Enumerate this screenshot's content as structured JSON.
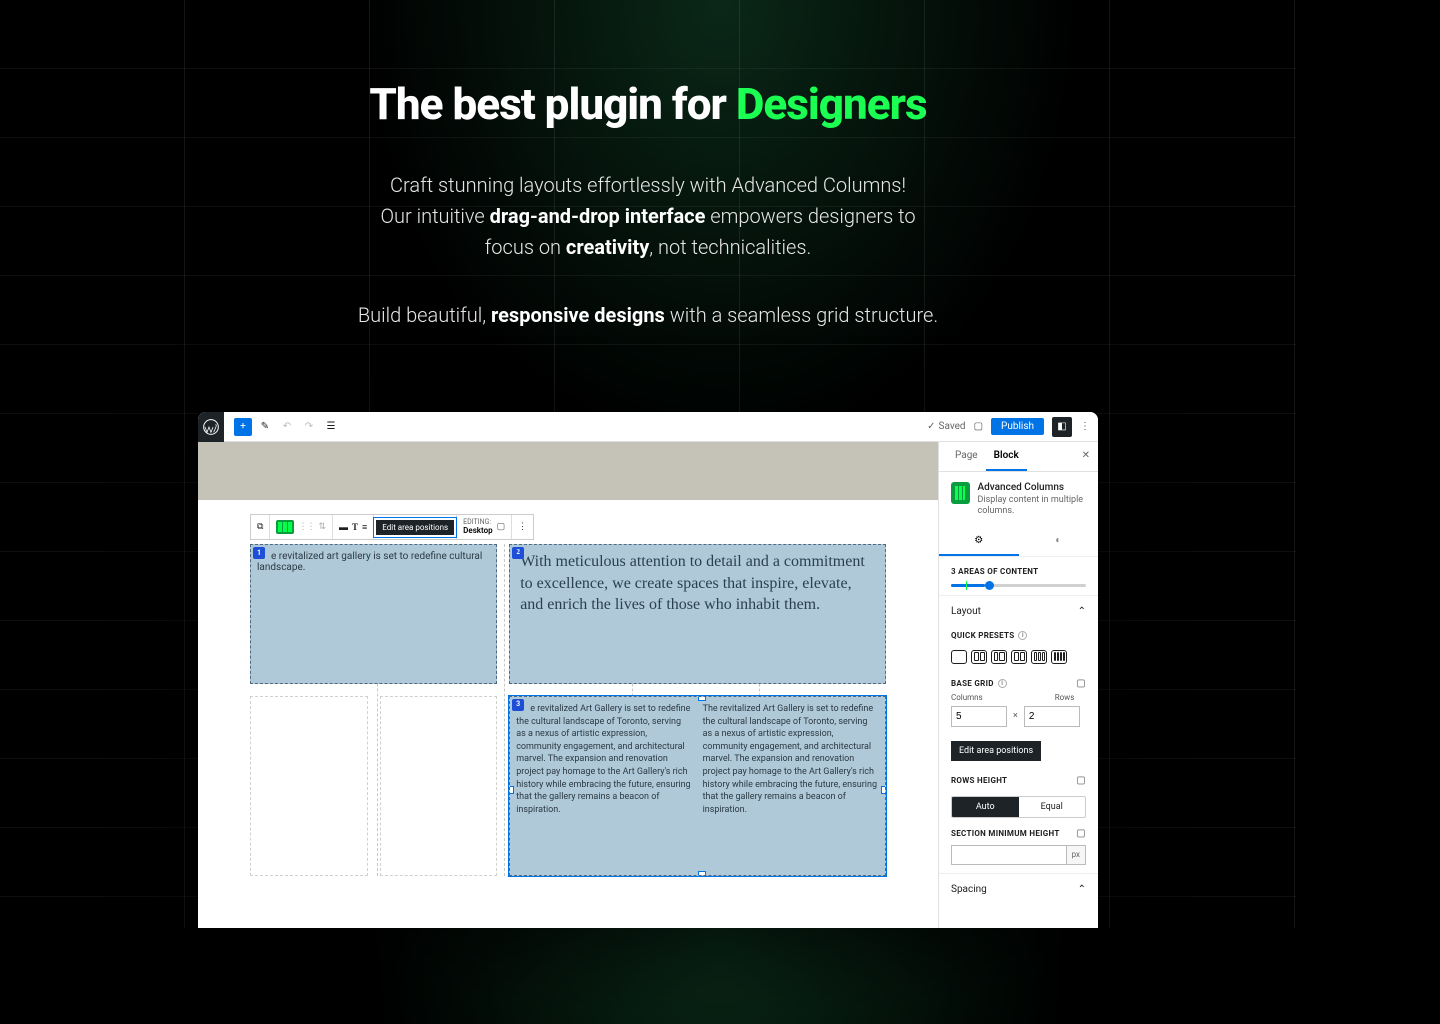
{
  "hero": {
    "title_prefix": "The best plugin for ",
    "title_accent": "Designers",
    "line1": "Craft stunning layouts effortlessly with Advanced Columns!",
    "line2a": "Our intuitive ",
    "line2b": "drag-and-drop interface",
    "line2c": " empowers designers to",
    "line3a": "focus on ",
    "line3b": "creativity",
    "line3c": ", not technicalities.",
    "line4a": "Build beautiful, ",
    "line4b": "responsive designs",
    "line4c": " with a seamless grid structure."
  },
  "topbar": {
    "saved": "Saved",
    "publish": "Publish"
  },
  "toolbar": {
    "edit_positions": "Edit area positions",
    "editing_label": "EDITING:",
    "editing_value": "Desktop"
  },
  "canvas": {
    "area1_text": "e revitalized art gallery is set to redefine cultural landscape.",
    "area2_text": "With meticulous attention to detail and a commitment to excellence, we create spaces that inspire, elevate, and enrich the lives of those who inhabit them.",
    "area3_text": "e revitalized Art Gallery is set to redefine the cultural landscape of Toronto, serving as a nexus of artistic expression, community engagement, and architectural marvel. The expansion and renovation project pay homage to the Art Gallery's rich history while embracing the future, ensuring that the gallery remains a beacon of inspiration.",
    "area3b_text": "The revitalized Art Gallery is set to redefine the cultural landscape of Toronto, serving as a nexus of artistic expression, community engagement, and architectural marvel. The expansion and renovation project pay homage to the Art Gallery's rich history while embracing the future, ensuring that the gallery remains a beacon of inspiration."
  },
  "sidebar": {
    "tabs": {
      "page": "Page",
      "block": "Block"
    },
    "block_name": "Advanced Columns",
    "block_desc": "Display content in multiple columns.",
    "areas_label": "3 AREAS OF CONTENT",
    "layout": "Layout",
    "quick_presets": "QUICK PRESETS",
    "base_grid": "BASE GRID",
    "columns_label": "Columns",
    "rows_label": "Rows",
    "columns_value": "5",
    "rows_value": "2",
    "edit_positions": "Edit area positions",
    "rows_height": "ROWS HEIGHT",
    "rows_height_auto": "Auto",
    "rows_height_equal": "Equal",
    "section_min_height": "SECTION MINIMUM HEIGHT",
    "px": "px",
    "spacing": "Spacing"
  }
}
